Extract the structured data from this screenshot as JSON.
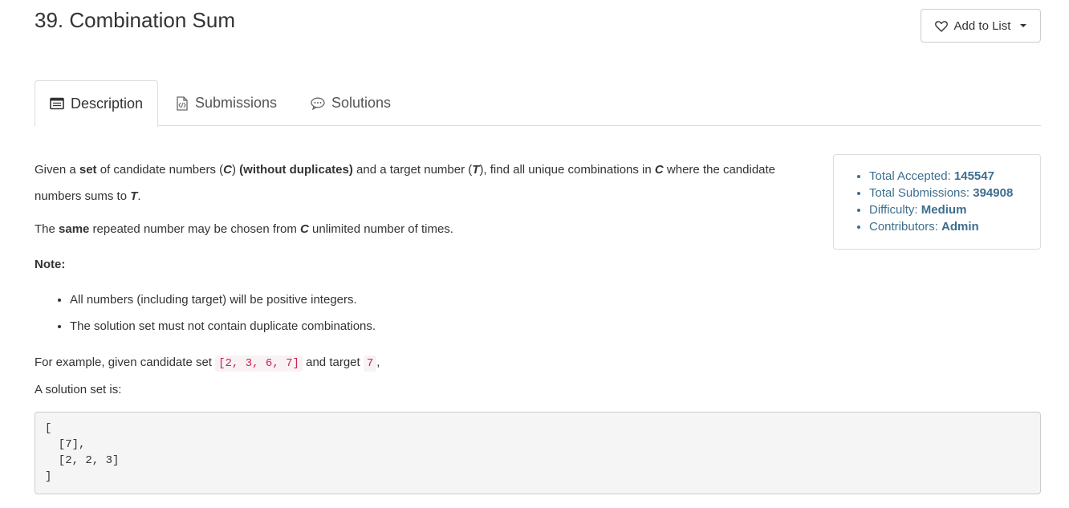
{
  "problem": {
    "title": "39. Combination Sum"
  },
  "add_to_list": {
    "label": "Add to List"
  },
  "tabs": [
    {
      "label": "Description"
    },
    {
      "label": "Submissions"
    },
    {
      "label": "Solutions"
    }
  ],
  "description": {
    "p1": {
      "a": "Given a ",
      "b": "set",
      "c": " of candidate numbers (",
      "d": "C",
      "e": ") ",
      "f": "(without duplicates)",
      "g": " and a target number (",
      "h": "T",
      "i": "), find all unique combinations in ",
      "j": "C",
      "k": " where the candidate numbers sums to ",
      "l": "T",
      "m": "."
    },
    "p2": {
      "a": "The ",
      "b": "same",
      "c": " repeated number may be chosen from ",
      "d": "C",
      "e": " unlimited number of times."
    },
    "note_label": "Note:",
    "notes": [
      "All numbers (including target) will be positive integers.",
      "The solution set must not contain duplicate combinations."
    ],
    "example": {
      "a": "For example, given candidate set ",
      "b": "[2, 3, 6, 7]",
      "c": " and target ",
      "d": "7",
      "e": ","
    },
    "solution_label": "A solution set is:",
    "solution_code": "[\n  [7],\n  [2, 2, 3]\n]"
  },
  "stats": {
    "accepted_label": "Total Accepted: ",
    "accepted_value": "145547",
    "submissions_label": "Total Submissions: ",
    "submissions_value": "394908",
    "difficulty_label": "Difficulty: ",
    "difficulty_value": "Medium",
    "contributors_label": "Contributors: ",
    "contributors_value": "Admin"
  },
  "colors": {
    "stats_text": "#3e6e8e",
    "code_text": "#c7254e"
  }
}
